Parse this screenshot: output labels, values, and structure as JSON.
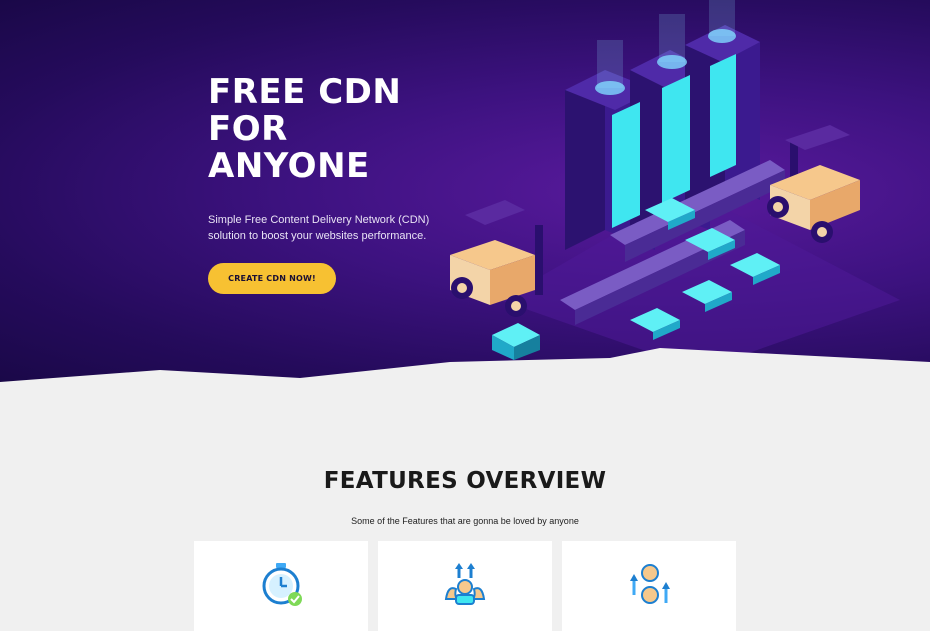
{
  "hero": {
    "title": "FREE CDN\nFOR\nANYONE",
    "subtitle": "Simple Free Content Delivery Network (CDN) solution to boost your websites performance.",
    "cta_label": "CREATE CDN NOW!"
  },
  "features": {
    "title": "FEATURES OVERVIEW",
    "subtitle": "Some of the Features that are gonna be loved by anyone",
    "cards": [
      {
        "icon": "stopwatch-check-icon"
      },
      {
        "icon": "muscle-growth-icon"
      },
      {
        "icon": "emotion-arrows-icon"
      }
    ]
  },
  "colors": {
    "hero_bg": "#2a0c66",
    "accent": "#f7c132",
    "server_glow": "#3fe6f0",
    "forklift": "#f6c88c"
  }
}
